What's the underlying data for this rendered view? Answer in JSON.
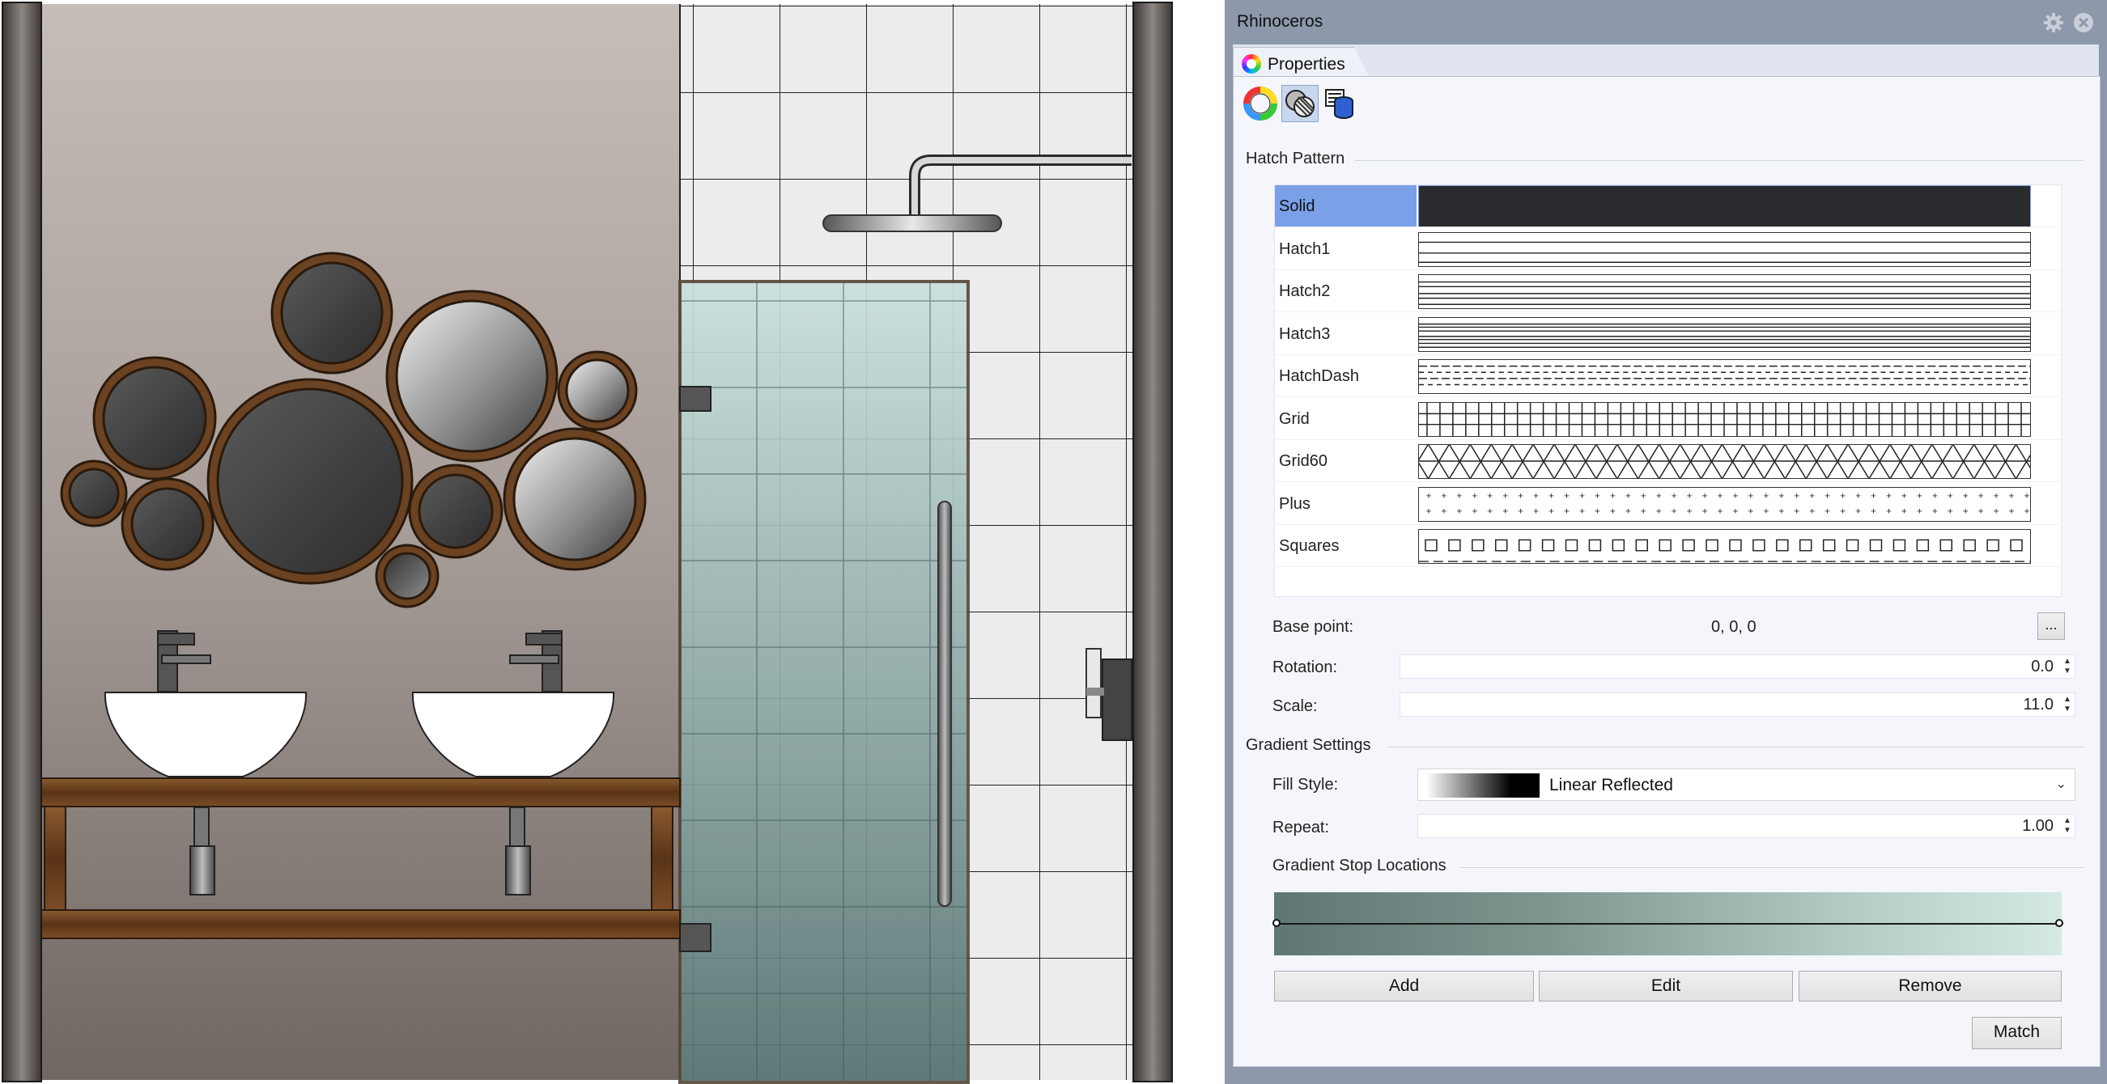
{
  "app": {
    "title": "Rhinoceros"
  },
  "tabs": [
    {
      "label": "Properties"
    }
  ],
  "toolbar": {
    "buttons": [
      {
        "icon": "material-color-wheel-icon"
      },
      {
        "icon": "hatch-properties-icon",
        "active": true
      },
      {
        "icon": "object-properties-icon"
      }
    ]
  },
  "hatch_pattern": {
    "section_title": "Hatch Pattern",
    "selected": "Solid",
    "items": [
      {
        "name": "Solid",
        "pattern": "solid"
      },
      {
        "name": "Hatch1",
        "pattern": "hatch1"
      },
      {
        "name": "Hatch2",
        "pattern": "hatch2"
      },
      {
        "name": "Hatch3",
        "pattern": "hatch3"
      },
      {
        "name": "HatchDash",
        "pattern": "dash"
      },
      {
        "name": "Grid",
        "pattern": "grid"
      },
      {
        "name": "Grid60",
        "pattern": "grid60"
      },
      {
        "name": "Plus",
        "pattern": "plus"
      },
      {
        "name": "Squares",
        "pattern": "squares"
      }
    ]
  },
  "base_point": {
    "label": "Base point:",
    "value": "0, 0, 0",
    "button_label": "..."
  },
  "rotation": {
    "label": "Rotation:",
    "value": "0.0"
  },
  "scale": {
    "label": "Scale:",
    "value": "11.0"
  },
  "gradient": {
    "section_title": "Gradient Settings",
    "fill_style_label": "Fill Style:",
    "fill_style_value": "Linear Reflected",
    "repeat_label": "Repeat:",
    "repeat_value": "1.00",
    "stops_label": "Gradient Stop Locations"
  },
  "buttons": {
    "add": "Add",
    "edit": "Edit",
    "remove": "Remove",
    "match": "Match"
  },
  "colors": {
    "panel_bg": "#8d98ab",
    "selection": "#7aa0e8",
    "wood_frame": "#6b4322",
    "glass_top": "#c6dedb",
    "glass_bottom": "#53706f"
  }
}
